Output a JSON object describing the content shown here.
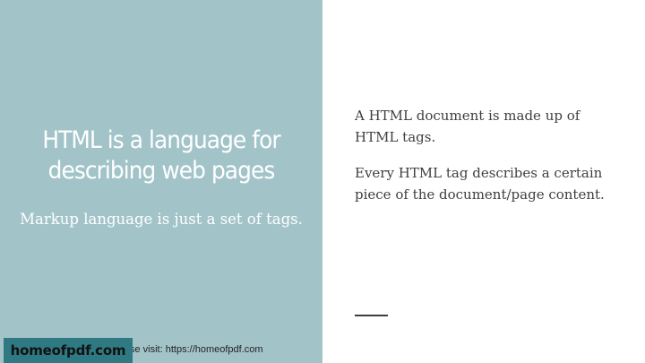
{
  "slide": {
    "title": "HTML is a language for describing web pages",
    "subtitle": "Markup language is just a set of tags.",
    "paragraphs": [
      "A HTML document is made up of HTML tags.",
      "Every HTML tag describes a certain piece of the document/page content."
    ]
  },
  "footer": {
    "note": "se visit: https://homeofpdf.com",
    "logo": "homeofpdf.com"
  },
  "colors": {
    "panel": "#a2c4c9",
    "text": "#3f3f3f",
    "logo_bg": "#2f7a82"
  }
}
